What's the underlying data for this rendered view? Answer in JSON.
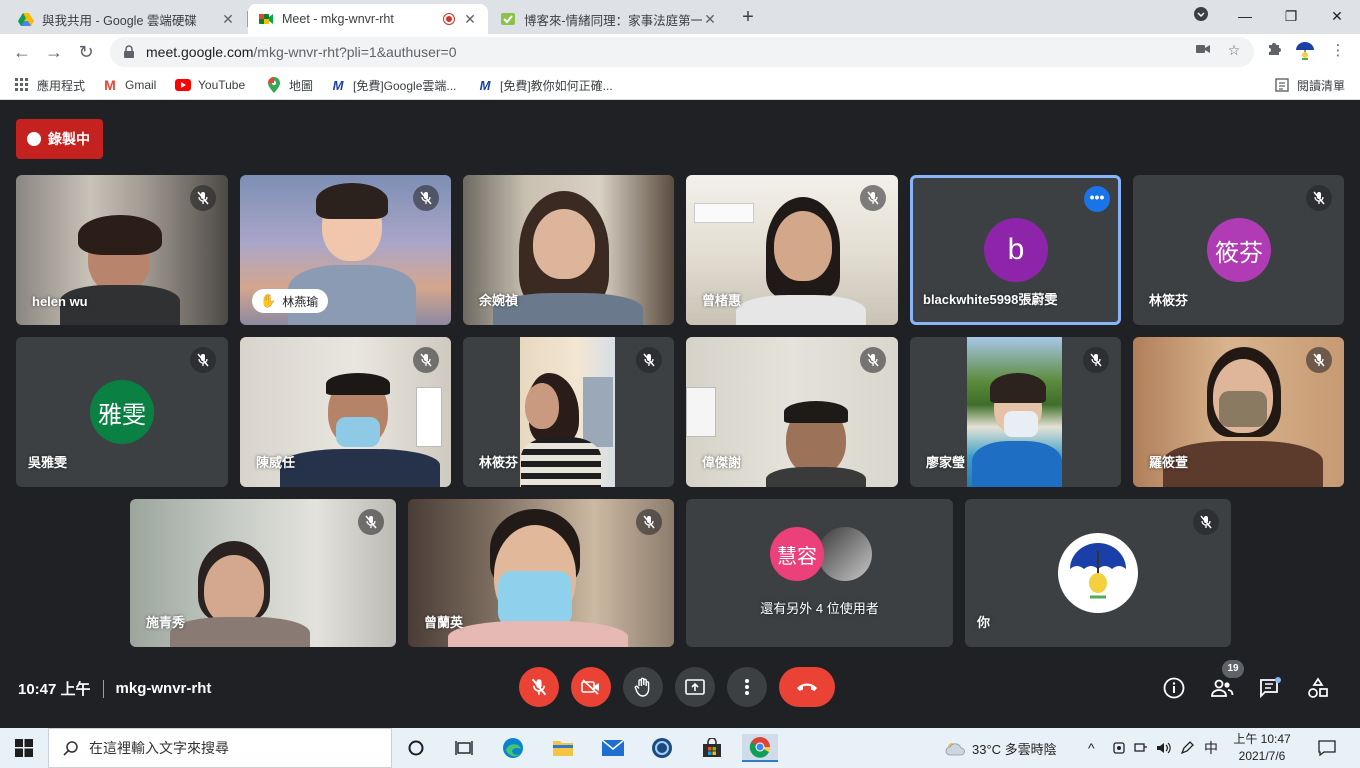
{
  "browser": {
    "tabs": [
      {
        "title": "與我共用 - Google 雲端硬碟",
        "active": false
      },
      {
        "title": "Meet - mkg-wnvr-rht",
        "active": true,
        "recording": true
      },
      {
        "title": "博客來-情緒同理：家事法庭第一",
        "active": false
      }
    ],
    "url_host": "meet.google.com",
    "url_path": "/mkg-wnvr-rht?pli=1&authuser=0",
    "bookmarks": [
      {
        "label": "應用程式",
        "icon": "apps-grid-icon"
      },
      {
        "label": "Gmail",
        "icon": "gmail-icon"
      },
      {
        "label": "YouTube",
        "icon": "youtube-icon"
      },
      {
        "label": "地圖",
        "icon": "maps-pin-icon"
      },
      {
        "label": "[免費]Google雲端...",
        "icon": "m-logo-icon"
      },
      {
        "label": "[免費]教你如何正確...",
        "icon": "m-logo-icon"
      }
    ],
    "reading_list": "閱讀清單"
  },
  "meet": {
    "recording_label": "錄製中",
    "tiles": [
      {
        "name": "helen wu",
        "type": "video"
      },
      {
        "name": "林燕瑜",
        "type": "video",
        "hand_raised": true
      },
      {
        "name": "余婉禎",
        "type": "video"
      },
      {
        "name": "曾楮惠",
        "type": "video"
      },
      {
        "name": "blackwhite5998張蔚雯",
        "type": "avatar",
        "initial": "b",
        "color": "#8e24aa",
        "selected": true
      },
      {
        "name": "林筱芬",
        "type": "avatar",
        "initial": "筱芬",
        "color": "#b13bb5"
      },
      {
        "name": "吳雅雯",
        "type": "avatar",
        "initial": "雅雯",
        "color": "#0b8043"
      },
      {
        "name": "陳威任",
        "type": "video"
      },
      {
        "name": "林筱芬",
        "type": "video"
      },
      {
        "name": "偉傑謝",
        "type": "video"
      },
      {
        "name": "廖家瑩",
        "type": "video"
      },
      {
        "name": "羅筱萱",
        "type": "video"
      },
      {
        "name": "施青秀",
        "type": "video"
      },
      {
        "name": "曾蘭英",
        "type": "video"
      },
      {
        "name": "還有另外 4 位使用者",
        "type": "others",
        "initial": "慧容",
        "color": "#ec407a"
      },
      {
        "name": "你",
        "type": "self"
      }
    ],
    "time": "10:47 上午",
    "meeting_code": "mkg-wnvr-rht",
    "participant_count": "19"
  },
  "taskbar": {
    "search_placeholder": "在這裡輸入文字來搜尋",
    "weather": "33°C 多雲時陰",
    "ime": "中",
    "clock_time": "上午 10:47",
    "clock_date": "2021/7/6"
  }
}
